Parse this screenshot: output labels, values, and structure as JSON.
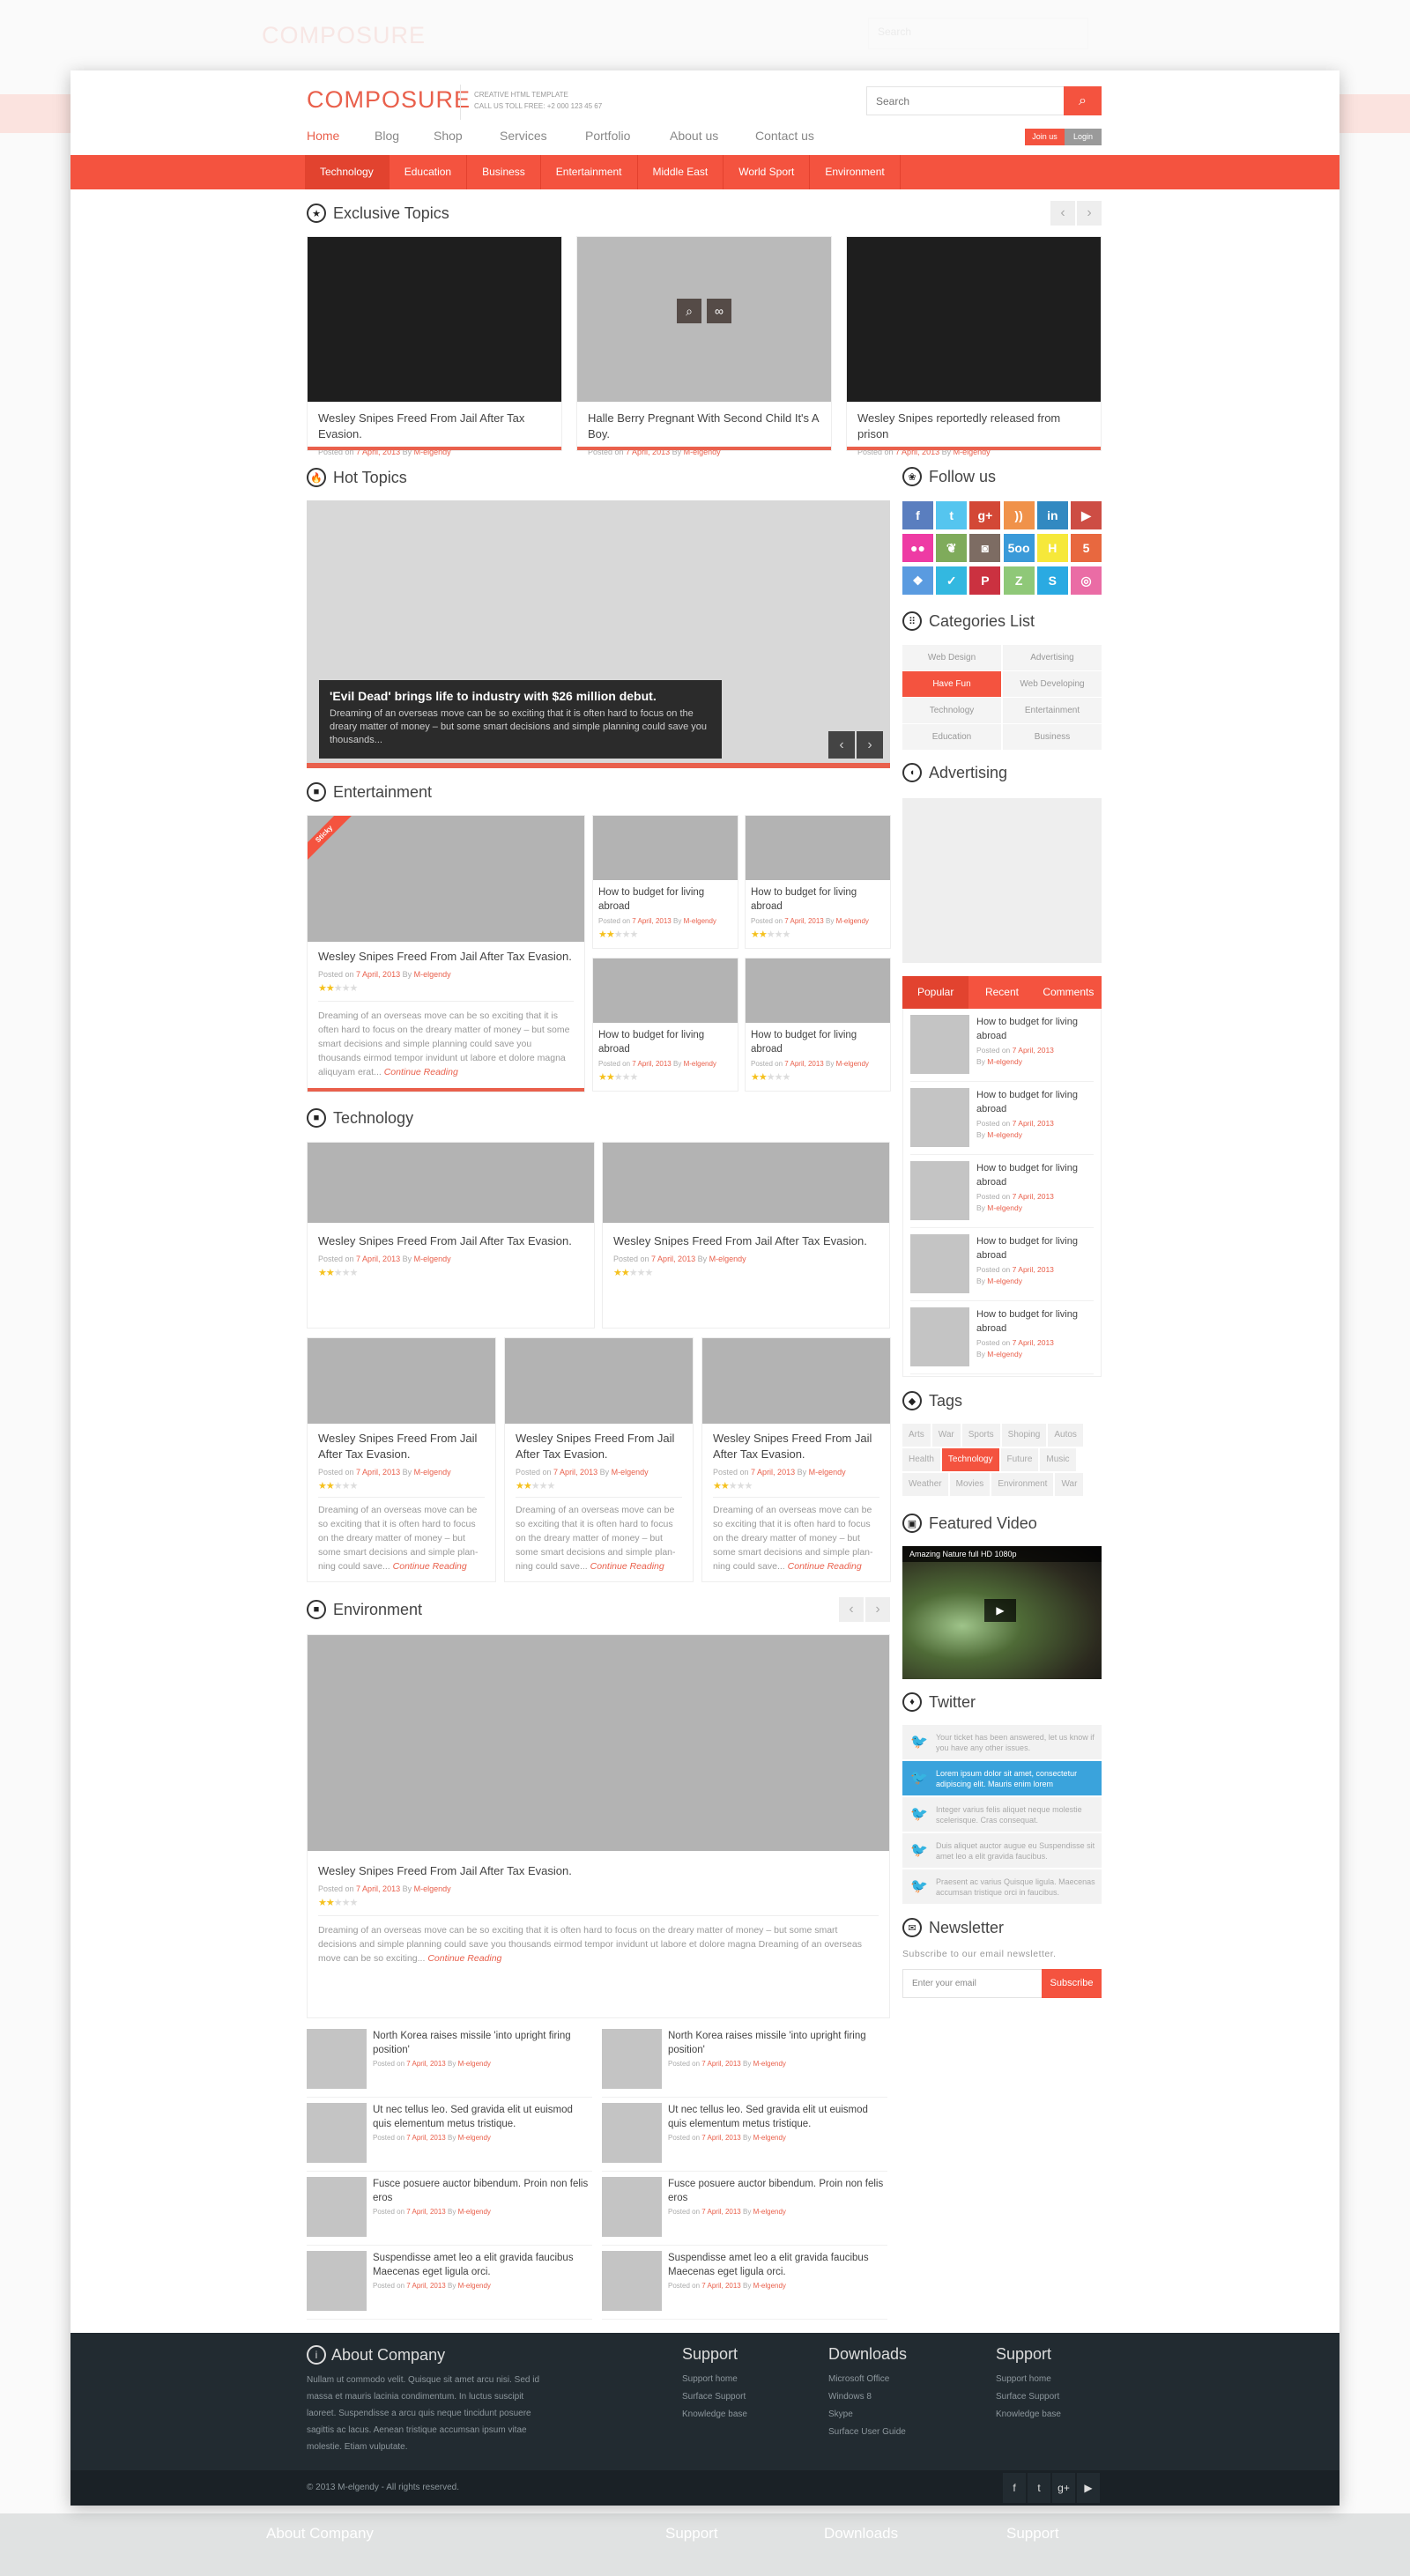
{
  "header": {
    "logo": "COMPOSURE",
    "tagline": "CREATIVE HTML TEMPLATE",
    "phone": "CALL US TOLL FREE: +2 000 123 45 67",
    "search_placeholder": "Search",
    "join": "Join us",
    "login": "Login",
    "nav": [
      "Home",
      "Blog",
      "Shop",
      "Services",
      "Portfolio",
      "About us",
      "Contact us"
    ],
    "nav_active": 0
  },
  "categories_bar": {
    "items": [
      "Technology",
      "Education",
      "Business",
      "Entertainment",
      "Middle East",
      "World Sport",
      "Environment"
    ],
    "active": 0
  },
  "meta": {
    "posted": "Posted on",
    "date": "7 April, 2013",
    "by": "By",
    "author": "M-elgendy"
  },
  "colors": {
    "accent": "#f4533f",
    "footer": "#222b31",
    "twitter": "#3aa3dc"
  },
  "exclusive": {
    "title": "Exclusive Topics",
    "cards": [
      {
        "title": "Wesley Snipes Freed From Jail After Tax Evasion.",
        "image": "dark"
      },
      {
        "title": "Halle Berry Pregnant With Second Child It's A Boy.",
        "image": "light"
      },
      {
        "title": "Wesley Snipes reportedly released from prison",
        "image": "dark"
      }
    ]
  },
  "hot": {
    "title": "Hot Topics",
    "slide_title": "'Evil Dead' brings life to industry with $26 million debut.",
    "slide_text": "Dreaming of an overseas move can be so exciting that it is often hard to focus on the dreary matter of money – but some smart decisions and simple planning could save you thousands..."
  },
  "entertainment": {
    "title": "Entertainment",
    "sticky": "Sticky",
    "main": {
      "title": "Wesley Snipes Freed From Jail After Tax Evasion.",
      "rating": 2,
      "excerpt": "Dreaming of an overseas move can be so exciting that it is often hard to focus on the dreary matter of money – but some smart decisions and simple planning could save you thousands eirmod tempor invidunt ut labore et dolore magna aliquyam erat...",
      "more": "Continue Reading"
    },
    "small": [
      {
        "title": "How to budget for living abroad",
        "rating": 2
      },
      {
        "title": "How to budget for living abroad",
        "rating": 2
      },
      {
        "title": "How to budget for living abroad",
        "rating": 2
      },
      {
        "title": "How to budget for living abroad",
        "rating": 2
      }
    ]
  },
  "technology": {
    "title": "Technology",
    "top": [
      {
        "title": "Wesley Snipes Freed From Jail After Tax Evasion.",
        "rating": 2
      },
      {
        "title": "Wesley Snipes Freed From Jail After Tax Evasion.",
        "rating": 2
      }
    ],
    "bottom": [
      {
        "title": "Wesley Snipes Freed From Jail After Tax Evasion.",
        "rating": 2,
        "excerpt": "Dreaming of an overseas move can be so exciting that it is often hard to focus on the dreary matter of money – but some smart decisions and simple plan-ning could save...",
        "more": "Continue Reading"
      },
      {
        "title": "Wesley Snipes Freed From Jail After Tax Evasion.",
        "rating": 2,
        "excerpt": "Dreaming of an overseas move can be so exciting that it is often hard to focus on the dreary matter of money – but some smart decisions and simple plan-ning could save...",
        "more": "Continue Reading"
      },
      {
        "title": "Wesley Snipes Freed From Jail After Tax Evasion.",
        "rating": 2,
        "excerpt": "Dreaming of an overseas move can be so exciting that it is often hard to focus on the dreary matter of money – but some smart decisions and simple plan-ning could save...",
        "more": "Continue Reading"
      }
    ]
  },
  "environment": {
    "title": "Environment",
    "main": {
      "title": "Wesley Snipes Freed From Jail After Tax Evasion.",
      "rating": 2,
      "excerpt": "Dreaming of an overseas move can be so exciting that it is often hard to focus on the dreary matter of money – but some smart decisions and simple planning could save you thousands eirmod tempor invidunt ut labore et dolore magna Dreaming of an overseas move can be so exciting...",
      "more": "Continue Reading"
    },
    "list": [
      "North Korea raises missile 'into upright firing position'",
      "North Korea raises missile 'into upright firing position'",
      "Ut nec tellus leo. Sed gravida elit ut euismod quis elementum metus tristique.",
      "Ut nec tellus leo. Sed gravida elit ut euismod quis elementum metus tristique.",
      "Fusce posuere auctor bibendum. Proin non felis eros",
      "Fusce posuere auctor bibendum. Proin non felis eros",
      "Suspendisse amet leo a elit gravida faucibus Maecenas eget ligula orci.",
      "Suspendisse amet leo a elit gravida faucibus Maecenas eget ligula orci."
    ]
  },
  "sidebar": {
    "follow_title": "Follow us",
    "social": [
      {
        "icon": "facebook",
        "glyph": "f",
        "color": "#5a7ebf"
      },
      {
        "icon": "twitter",
        "glyph": "t",
        "color": "#55c5ef"
      },
      {
        "icon": "google-plus",
        "glyph": "g+",
        "color": "#d34836"
      },
      {
        "icon": "rss",
        "glyph": "))",
        "color": "#f0924a"
      },
      {
        "icon": "linkedin",
        "glyph": "in",
        "color": "#3289c1"
      },
      {
        "icon": "youtube",
        "glyph": "▶",
        "color": "#cd4d44"
      },
      {
        "icon": "flickr",
        "glyph": "●●",
        "color": "#ee3ba4"
      },
      {
        "icon": "evernote",
        "glyph": "❦",
        "color": "#7fab5b"
      },
      {
        "icon": "instagram",
        "glyph": "◙",
        "color": "#7d6c63"
      },
      {
        "icon": "500px",
        "glyph": "5oo",
        "color": "#3a9ad9"
      },
      {
        "icon": "hype",
        "glyph": "H",
        "color": "#f6e83a"
      },
      {
        "icon": "html5",
        "glyph": "5",
        "color": "#e8683f"
      },
      {
        "icon": "dropbox",
        "glyph": "❖",
        "color": "#5a9be0"
      },
      {
        "icon": "check",
        "glyph": "✓",
        "color": "#33b8e0"
      },
      {
        "icon": "pinterest",
        "glyph": "P",
        "color": "#cb3140"
      },
      {
        "icon": "zerply",
        "glyph": "Z",
        "color": "#8fc878"
      },
      {
        "icon": "skype",
        "glyph": "S",
        "color": "#2aaae2"
      },
      {
        "icon": "dribbble",
        "glyph": "◎",
        "color": "#ea6ca5"
      }
    ],
    "categories_title": "Categories List",
    "categories": [
      "Web Design",
      "Advertising",
      "Have Fun",
      "Web Developing",
      "Technology",
      "Entertainment",
      "Education",
      "Business"
    ],
    "categories_active": 2,
    "advertising_title": "Advertising",
    "tabs": [
      "Popular",
      "Recent",
      "Comments"
    ],
    "tabs_active": 0,
    "popular": [
      "How to budget for living abroad",
      "How to budget for living abroad",
      "How to budget for living abroad",
      "How to budget for living abroad",
      "How to budget for living abroad"
    ],
    "tags_title": "Tags",
    "tags": [
      "Arts",
      "War",
      "Sports",
      "Shoping",
      "Autos",
      "Health",
      "Technology",
      "Future",
      "Music",
      "Weather",
      "Movies",
      "Environment",
      "War"
    ],
    "tags_active": 6,
    "video_title": "Featured Video",
    "video_caption": "Amazing Nature full HD 1080p",
    "twitter_title": "Twitter",
    "tweets": [
      "Your ticket has been answered, let us know if you have any other issues.",
      "Lorem ipsum dolor sit amet, consectetur adipiscing elit. Mauris enim lorem",
      "Integer varius felis aliquet neque molestie scelerisque. Cras consequat.",
      "Duis aliquet auctor augue eu Suspendisse sit amet leo a elit gravida faucibus.",
      "Praesent ac varius Quisque ligula. Maecenas accumsan tristique orci in faucibus."
    ],
    "tweets_active": 1,
    "newsletter_title": "Newsletter",
    "newsletter_text": "Subscribe to our email newsletter.",
    "email_placeholder": "Enter your email",
    "subscribe": "Subscribe"
  },
  "footer": {
    "about_title": "About Company",
    "about_text": "Nullam ut commodo velit. Quisque sit amet arcu nisi. Sed id massa et mauris lacinia condimentum. In luctus suscipit laoreet. Suspendisse a arcu quis neque tincidunt posuere sagittis ac lacus. Aenean tristique accumsan ipsum vitae molestie. Etiam vulputate.",
    "columns": [
      {
        "title": "Support",
        "links": [
          "Support home",
          "Surface Support",
          "Knowledge base"
        ]
      },
      {
        "title": "Downloads",
        "links": [
          "Microsoft Office",
          "Windows 8",
          "Skype",
          "Surface User Guide"
        ]
      },
      {
        "title": "Support",
        "links": [
          "Support home",
          "Surface Support",
          "Knowledge base"
        ]
      }
    ],
    "copyright": "© 2013 M-elgendy - All rights reserved.",
    "social": [
      {
        "icon": "facebook",
        "glyph": "f"
      },
      {
        "icon": "twitter",
        "glyph": "t"
      },
      {
        "icon": "google-plus",
        "glyph": "g+"
      },
      {
        "icon": "youtube",
        "glyph": "▶"
      }
    ]
  }
}
